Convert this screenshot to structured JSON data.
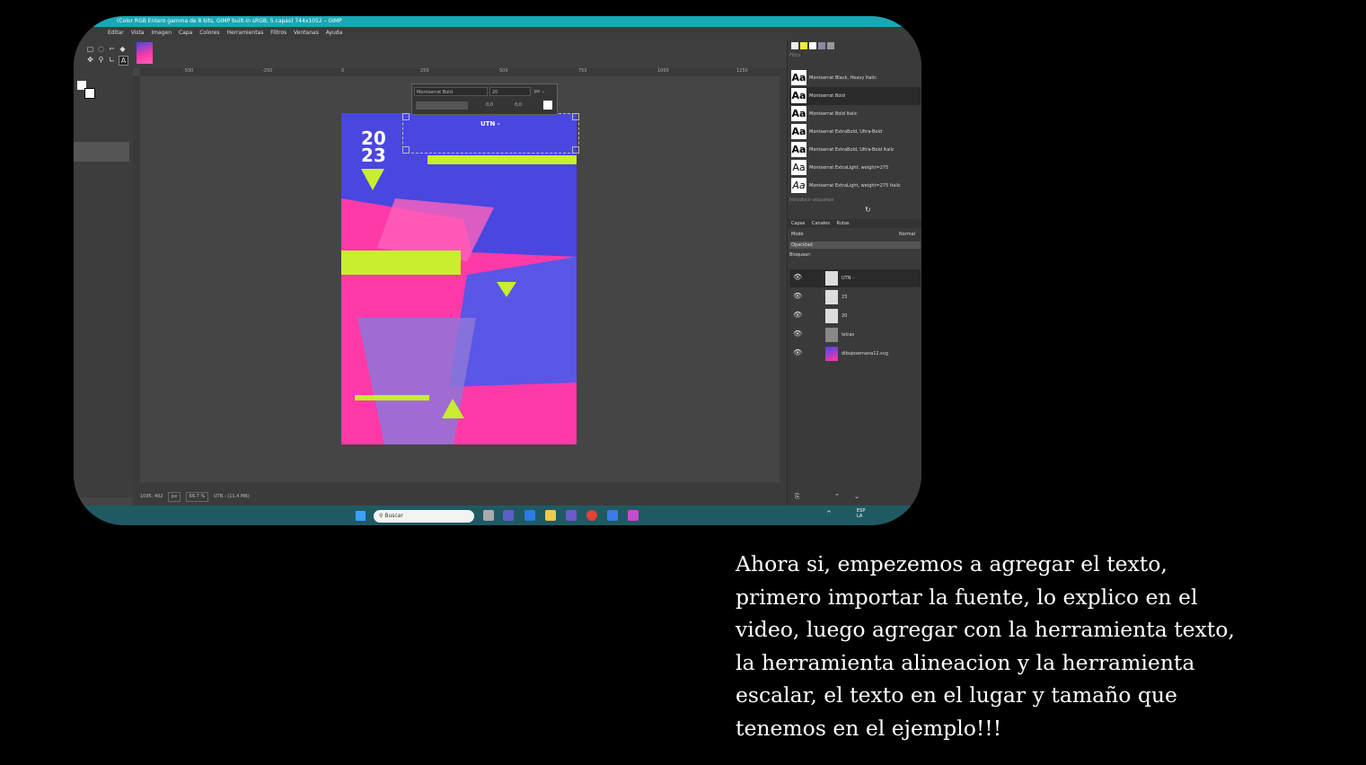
{
  "window": {
    "title": "(Color RGB Entero gamma de 8 bits, GIMP built-in sRGB, 5 capas) 744x1052 – GIMP"
  },
  "menu": [
    "Editar",
    "Vista",
    "Imagen",
    "Capa",
    "Colores",
    "Herramientas",
    "Filtros",
    "Ventanas",
    "Ayuda"
  ],
  "ruler_ticks": [
    "-500",
    "-250",
    "0",
    "250",
    "500",
    "750",
    "1000",
    "1250"
  ],
  "text_tool": {
    "font": "Montserrat Bold",
    "size": "20",
    "unit": "px",
    "offset_x": "0,0",
    "offset_y": "0,0"
  },
  "poster": {
    "year_line1": "20",
    "year_line2": "23",
    "heading_text": "UTN -",
    "colors": {
      "pink": "#ff3aa8",
      "blue": "#4a46e0",
      "lime": "#c8ee2e",
      "lavender": "#8f76d8"
    }
  },
  "fonts_panel": {
    "filter_placeholder": "Filtro",
    "tag_placeholder": "Introducir etiquetas",
    "fonts": [
      "Montserrat Black, Heavy Italic",
      "Montserrat Bold",
      "Montserrat Bold Italic",
      "Montserrat ExtraBold, Ultra-Bold",
      "Montserrat ExtraBold, Ultra-Bold Italic",
      "Montserrat ExtraLight, weight=275",
      "Montserrat ExtraLight, weight=275 Italic"
    ]
  },
  "layers_panel": {
    "tabs": [
      "Capas",
      "Canales",
      "Rutas"
    ],
    "mode_label": "Modo",
    "mode_value": "Normal",
    "opacity_label": "Opacidad",
    "lock_label": "Bloquear:",
    "layers": [
      "UTN -",
      "23",
      "20",
      "letras",
      "dibujosemana12.svg"
    ]
  },
  "status": {
    "coords": "1095, 402",
    "unit": "px",
    "zoom": "66.7 %",
    "info": "UTN - (11,4 MB)"
  },
  "taskbar": {
    "search_placeholder": "Buscar",
    "lang": "ESP",
    "lang2": "LA"
  },
  "caption": "Ahora si, empezemos a agregar el texto,\nprimero importar la fuente, lo explico en el\nvideo, luego agregar con la herramienta texto,\nla herramienta alineacion y la herramienta\nescalar, el texto en el lugar y tamaño que\ntenemos en el ejemplo!!!"
}
